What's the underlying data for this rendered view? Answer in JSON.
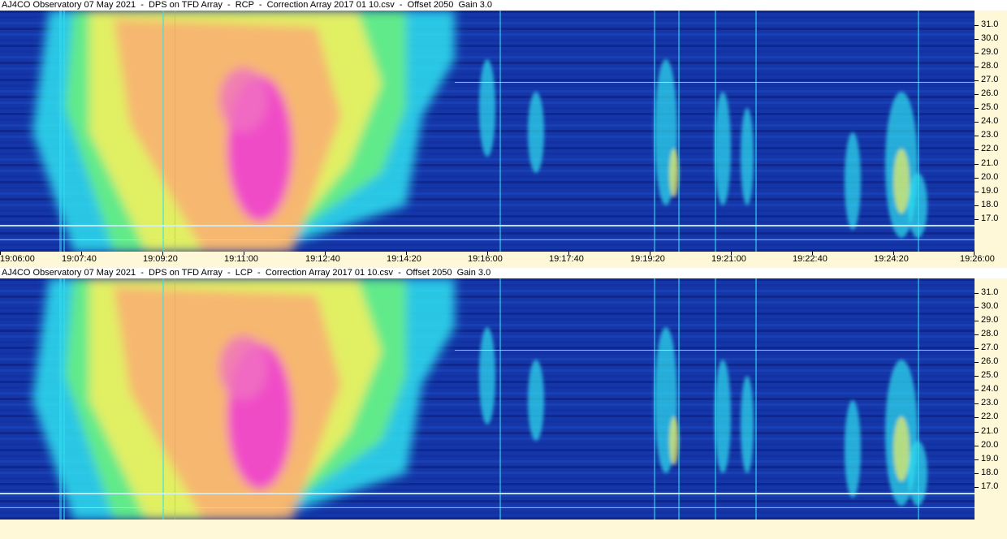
{
  "panels": [
    {
      "title": "AJ4CO Observatory 07 May 2021  -  DPS on TFD Array  -  RCP  -  Correction Array 2017 01 10.csv  -  Offset 2050  Gain 3.0",
      "polarization": "RCP"
    },
    {
      "title": "AJ4CO Observatory 07 May 2021  -  DPS on TFD Array  -  LCP  -  Correction Array 2017 01 10.csv  -  Offset 2050  Gain 3.0",
      "polarization": "LCP"
    }
  ],
  "y_ticks": [
    "31.0",
    "30.0",
    "29.0",
    "28.0",
    "27.0",
    "26.0",
    "25.0",
    "24.0",
    "23.0",
    "22.0",
    "21.0",
    "20.0",
    "19.0",
    "18.0",
    "17.0"
  ],
  "x_ticks": [
    "19:06:00",
    "19:07:40",
    "19:09:20",
    "19:11:00",
    "19:12:40",
    "19:14:20",
    "19:16:00",
    "19:17:40",
    "19:19:20",
    "19:21:00",
    "19:22:40",
    "19:24:20",
    "19:26:00"
  ],
  "colors": {
    "background_blue": "#1436a8",
    "deep_blue": "#0a1e7a",
    "cyan": "#2ee0f0",
    "green": "#6cf07a",
    "yellow": "#f0f060",
    "orange": "#f8b070",
    "magenta": "#f040d0",
    "axis_bg": "#fff8d8"
  }
}
